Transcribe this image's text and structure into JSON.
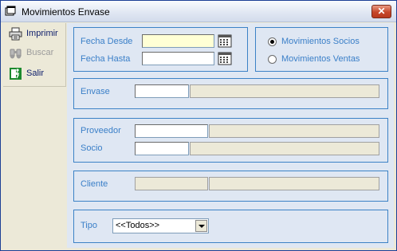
{
  "window": {
    "title": "Movimientos Envase",
    "close_glyph": "✕"
  },
  "toolbar": {
    "items": [
      {
        "label": "Imprimir",
        "icon": "printer-icon",
        "enabled": true
      },
      {
        "label": "Buscar",
        "icon": "binoculars-icon",
        "enabled": false
      },
      {
        "label": "Salir",
        "icon": "exit-icon",
        "enabled": true
      }
    ]
  },
  "dates": {
    "desde_label": "Fecha Desde",
    "desde_value": "",
    "hasta_label": "Fecha Hasta",
    "hasta_value": ""
  },
  "movement_type": {
    "options": [
      {
        "label": "Movimientos Socios",
        "checked": true
      },
      {
        "label": "Movimientos Ventas",
        "checked": false
      }
    ]
  },
  "envase": {
    "label": "Envase",
    "code": "",
    "description": ""
  },
  "proveedor": {
    "label": "Proveedor",
    "code": "",
    "description": ""
  },
  "socio": {
    "label": "Socio",
    "code": "",
    "description": ""
  },
  "cliente": {
    "label": "Cliente",
    "code": "",
    "description": ""
  },
  "tipo": {
    "label": "Tipo",
    "selected": "<<Todos>>"
  },
  "colors": {
    "label_blue": "#3a7fc8",
    "group_border": "#3c82c6",
    "panel_bg": "#dfe7f3",
    "date_field_bg": "#ffffd5"
  }
}
